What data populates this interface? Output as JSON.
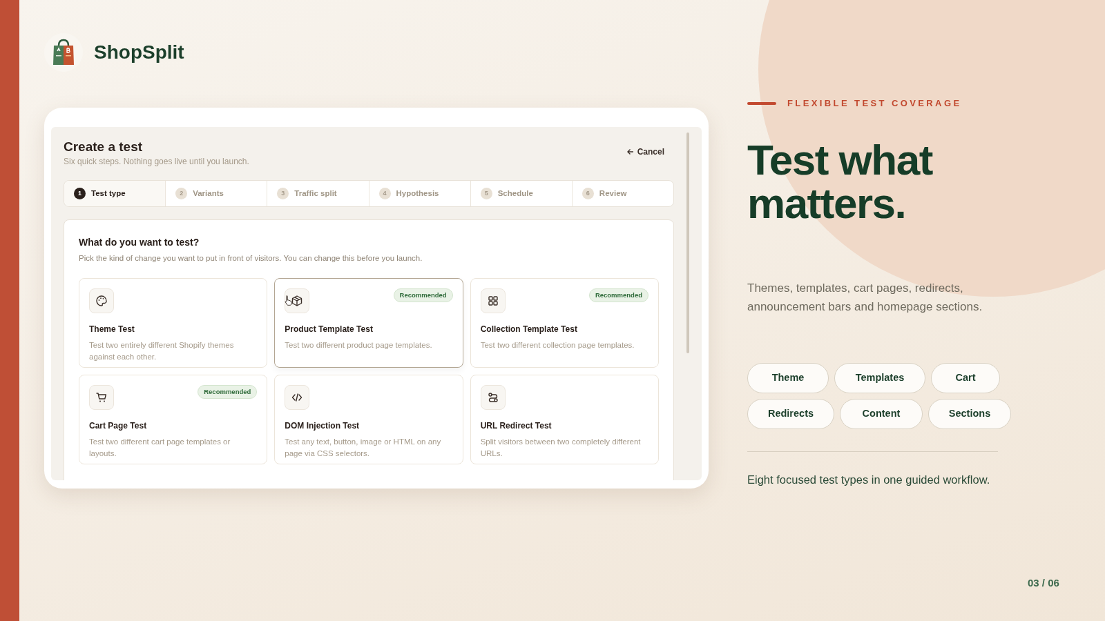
{
  "brand": {
    "name": "ShopSplit"
  },
  "app": {
    "title": "Create a test",
    "subtitle": "Six quick steps. Nothing goes live until you launch.",
    "cancel": "Cancel",
    "steps": [
      {
        "number": "1",
        "label": "Test type",
        "selected": true
      },
      {
        "number": "2",
        "label": "Variants",
        "selected": false
      },
      {
        "number": "3",
        "label": "Traffic split",
        "selected": false
      },
      {
        "number": "4",
        "label": "Hypothesis",
        "selected": false
      },
      {
        "number": "5",
        "label": "Schedule",
        "selected": false
      },
      {
        "number": "6",
        "label": "Review",
        "selected": false
      }
    ],
    "question": "What do you want to test?",
    "hint": "Pick the kind of change you want to put in front of visitors. You can change this before you launch.",
    "options": [
      {
        "title": "Theme Test",
        "description": "Test two entirely different Shopify themes against each other.",
        "selected": false
      },
      {
        "title": "Product Template Test",
        "description": "Test two different product page templates.",
        "badge": "Recommended",
        "selected": true
      },
      {
        "title": "Collection Template Test",
        "description": "Test two different collection page templates.",
        "badge": "Recommended",
        "selected": false
      },
      {
        "title": "Cart Page Test",
        "description": "Test two different cart page templates or layouts.",
        "badge": "Recommended",
        "selected": false
      },
      {
        "title": "DOM Injection Test",
        "description": "Test any text, button, image or HTML on any page via CSS selectors.",
        "selected": false
      },
      {
        "title": "URL Redirect Test",
        "description": "Split visitors between two completely different URLs.",
        "selected": false
      }
    ]
  },
  "eyebrow": "FLEXIBLE TEST COVERAGE",
  "headline": "Test what matters.",
  "lead": "Themes, templates, cart pages, redirects, announcement bars and homepage sections.",
  "chips": [
    [
      "Theme",
      "Templates",
      "Cart"
    ],
    [
      "Redirects",
      "Content",
      "Sections"
    ]
  ],
  "footnote": "Eight focused test types in one guided workflow.",
  "page_counter": "03 / 06"
}
